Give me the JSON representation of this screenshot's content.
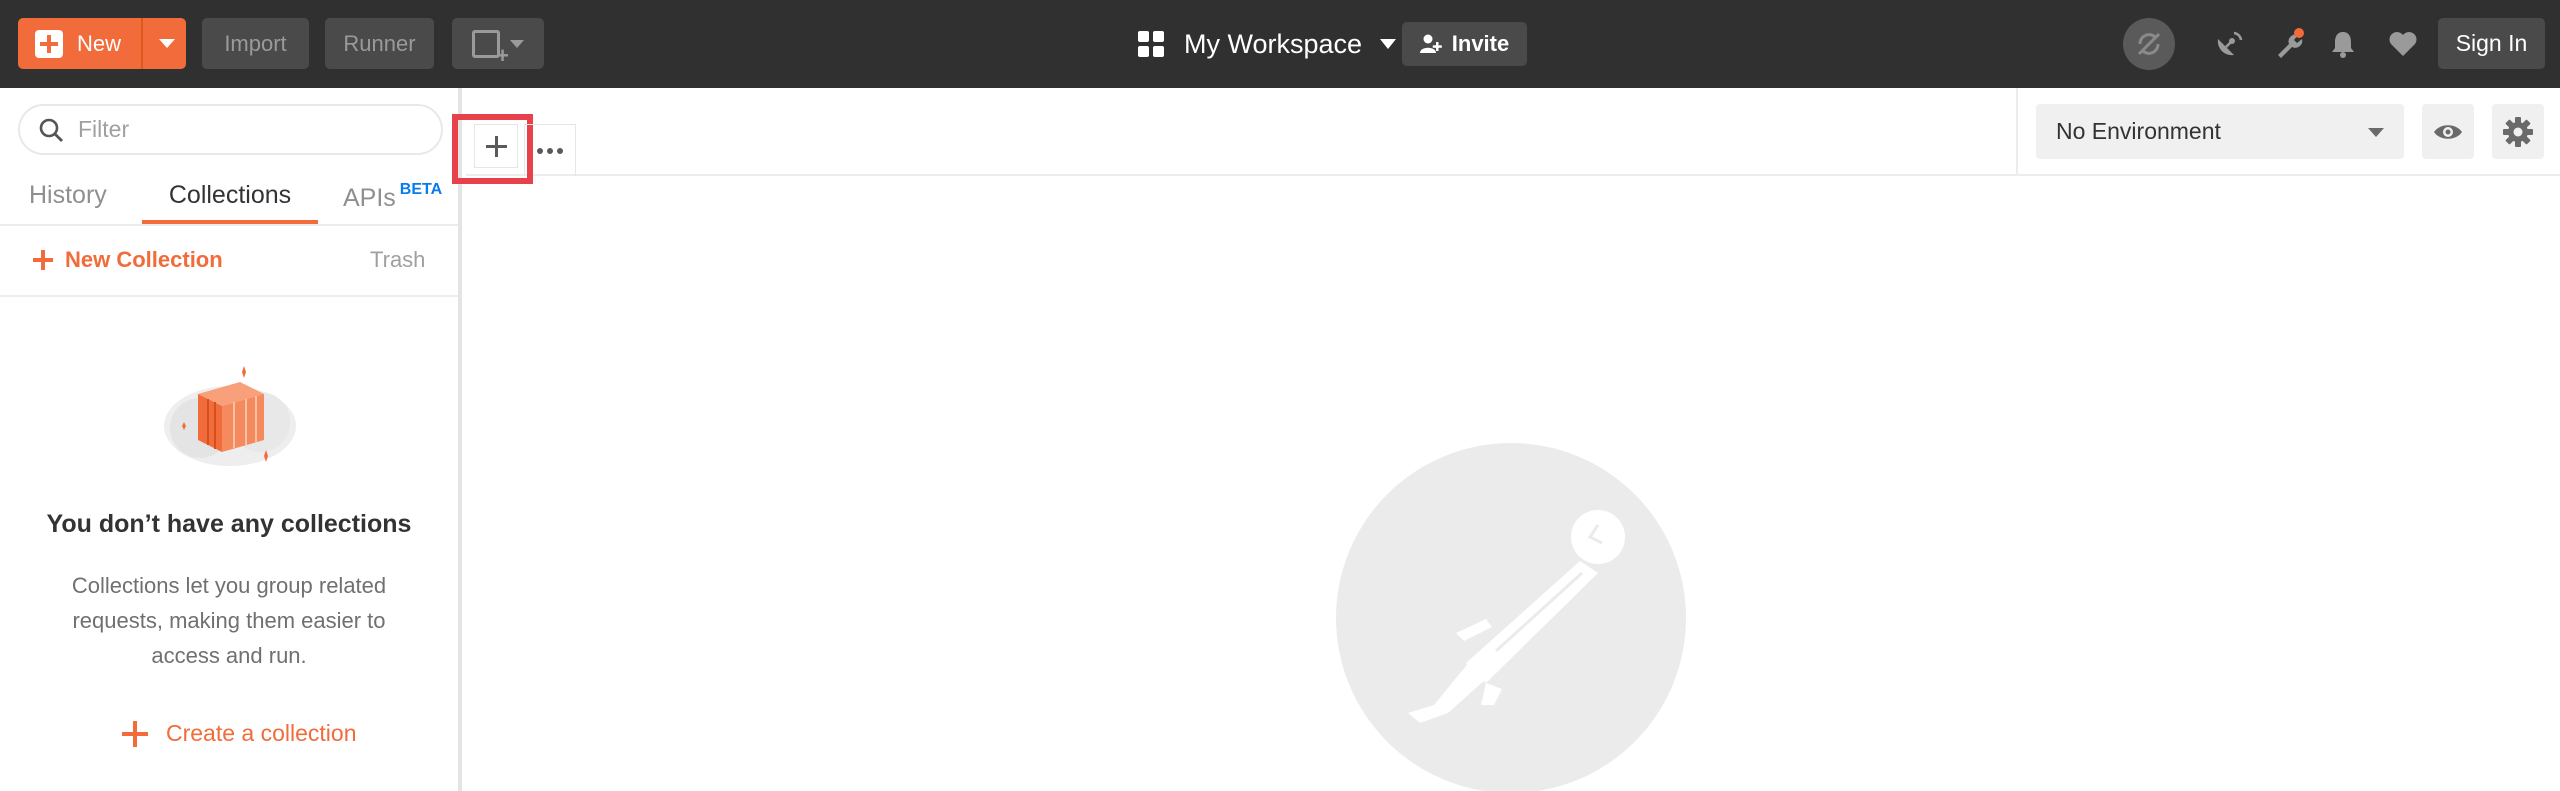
{
  "toolbar": {
    "new_label": "New",
    "import_label": "Import",
    "runner_label": "Runner"
  },
  "workspace": {
    "label": "My Workspace",
    "invite_label": "Invite"
  },
  "account": {
    "signin_label": "Sign In"
  },
  "sidebar": {
    "filter_placeholder": "Filter",
    "tabs": {
      "history": "History",
      "collections": "Collections",
      "apis": "APIs",
      "apis_badge": "BETA"
    },
    "new_collection_label": "New Collection",
    "trash_label": "Trash",
    "empty": {
      "title": "You don’t have any collections",
      "description": "Collections let you group related requests, making them easier to access and run.",
      "create_label": "Create a collection"
    }
  },
  "environment": {
    "selected": "No Environment"
  },
  "colors": {
    "accent": "#f26b3a",
    "topbar": "#303030",
    "highlight": "#e7414c",
    "beta": "#097bed"
  },
  "icons": [
    "plus-icon",
    "builder-icon",
    "grid-icon",
    "invite-icon",
    "sync-off-icon",
    "satellite-icon",
    "wrench-icon",
    "bell-icon",
    "heart-icon",
    "search-icon",
    "eye-icon",
    "gear-icon",
    "postman-logo"
  ]
}
